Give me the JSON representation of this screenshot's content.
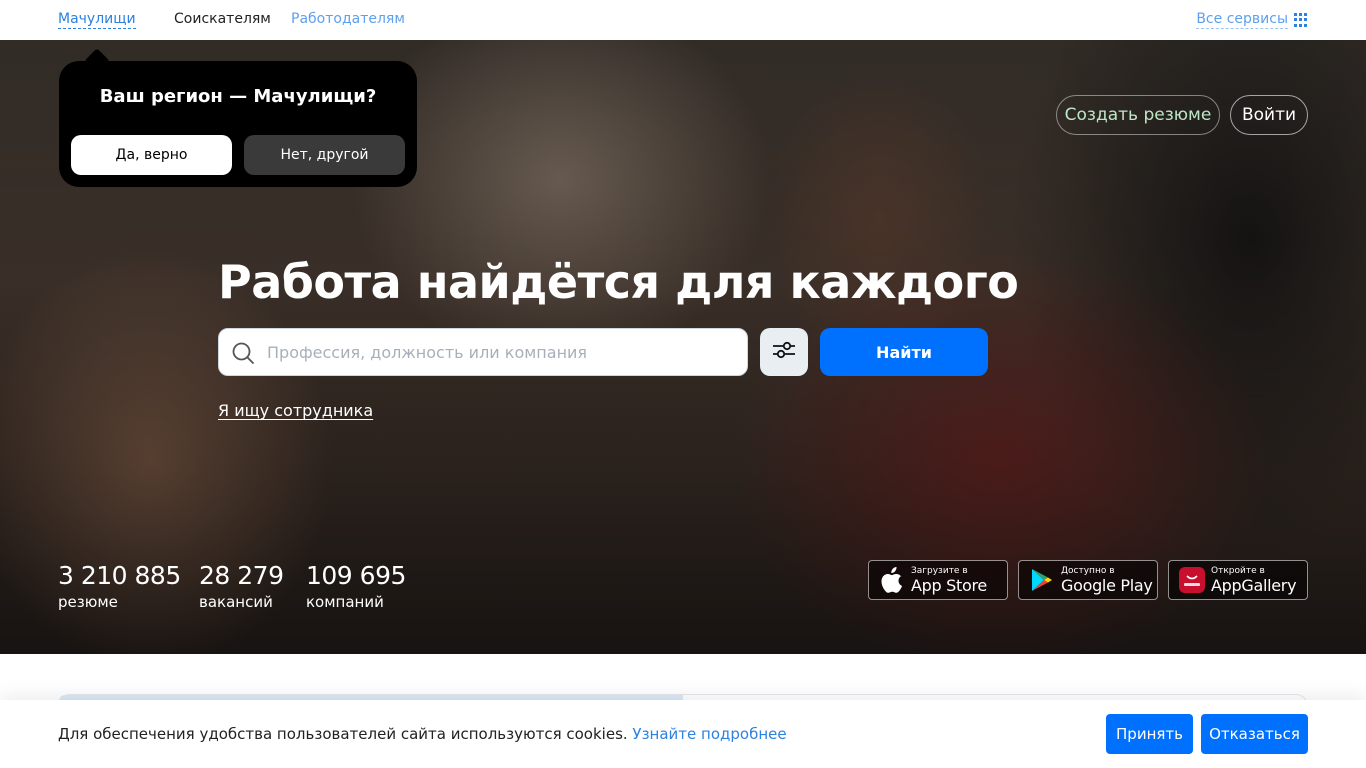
{
  "topnav": {
    "region": "Мачулищи",
    "seekers": "Соискателям",
    "employers": "Работодателям",
    "all_services": "Все сервисы",
    "all_services_icon": "grid-icon"
  },
  "region_popup": {
    "question": "Ваш регион — Мачулищи?",
    "yes": "Да, верно",
    "no": "Нет, другой"
  },
  "header": {
    "create_resume": "Создать резюме",
    "login": "Войти"
  },
  "hero": {
    "title": "Работа найдётся для каждого",
    "search_placeholder": "Профессия, должность или компания",
    "search_value": "",
    "find_button": "Найти",
    "employer_link": "Я ищу сотрудника",
    "filter_icon": "sliders-icon",
    "search_icon": "search-icon"
  },
  "stats": [
    {
      "value": "3 210 885",
      "label": "резюме"
    },
    {
      "value": "28 279",
      "label": "вакансий"
    },
    {
      "value": "109 695",
      "label": "компаний"
    }
  ],
  "stores": [
    {
      "small": "Загрузите в",
      "big": "App Store",
      "icon": "apple-icon"
    },
    {
      "small": "Доступно в",
      "big": "Google Play",
      "icon": "google-play-icon"
    },
    {
      "small": "Откройте в",
      "big": "AppGallery",
      "icon": "huawei-icon"
    }
  ],
  "cookie": {
    "text": "Для обеспечения удобства пользователей сайта используются cookies.",
    "more": "Узнайте подробнее",
    "accept": "Принять",
    "decline": "Отказаться"
  },
  "colors": {
    "accent": "#0070ff",
    "link": "#2d81e0",
    "popup_bg": "#000000"
  }
}
